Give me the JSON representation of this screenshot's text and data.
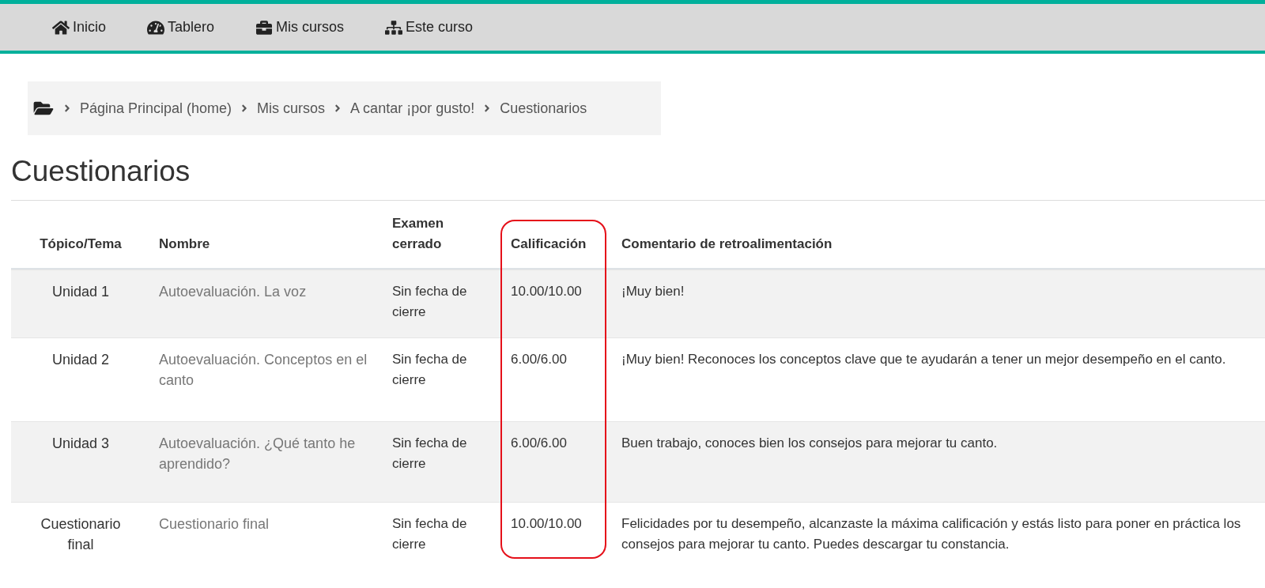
{
  "nav": [
    {
      "kind": "home",
      "label": "Inicio"
    },
    {
      "kind": "dashboard",
      "label": "Tablero"
    },
    {
      "kind": "courses",
      "label": "Mis cursos"
    },
    {
      "kind": "course",
      "label": "Este curso"
    }
  ],
  "breadcrumb": [
    "Página Principal (home)",
    "Mis cursos",
    "A cantar ¡por gusto!",
    "Cuestionarios"
  ],
  "title": "Cuestionarios",
  "table": {
    "columns": [
      {
        "label": "Tópico/Tema",
        "highlighted": false
      },
      {
        "label": "Examen\ncerrado",
        "highlighted": false
      },
      {
        "label": "Calificación",
        "highlighted": true
      },
      {
        "label": "Comentario de retroalimentación",
        "highlighted": false
      }
    ],
    "name_column": "Nombre",
    "rows": [
      {
        "topic": "Unidad 1",
        "name": "Autoevaluación. La voz",
        "closed": "Sin fecha de cierre",
        "grade": "10.00/10.00",
        "feedback": "¡Muy bien!"
      },
      {
        "topic": "Unidad 2",
        "name": "Autoevaluación. Conceptos en el canto",
        "closed": "Sin fecha de cierre",
        "grade": "6.00/6.00",
        "feedback": "¡Muy bien! Reconoces los conceptos clave que te ayudarán a tener un mejor desempeño en el canto."
      },
      {
        "topic": "Unidad 3",
        "name": "Autoevaluación. ¿Qué tanto he aprendido?",
        "closed": "Sin fecha de cierre",
        "grade": "6.00/6.00",
        "feedback": "Buen trabajo, conoces bien los consejos para mejorar tu canto."
      },
      {
        "topic": "Cuestionario final",
        "name": "Cuestionario final",
        "closed": "Sin fecha de cierre",
        "grade": "10.00/10.00",
        "feedback": "Felicidades por tu desempeño, alcanzaste la máxima calificación y estás listo para poner en práctica los consejos para mejorar tu canto. Puedes descargar tu constancia."
      }
    ]
  }
}
